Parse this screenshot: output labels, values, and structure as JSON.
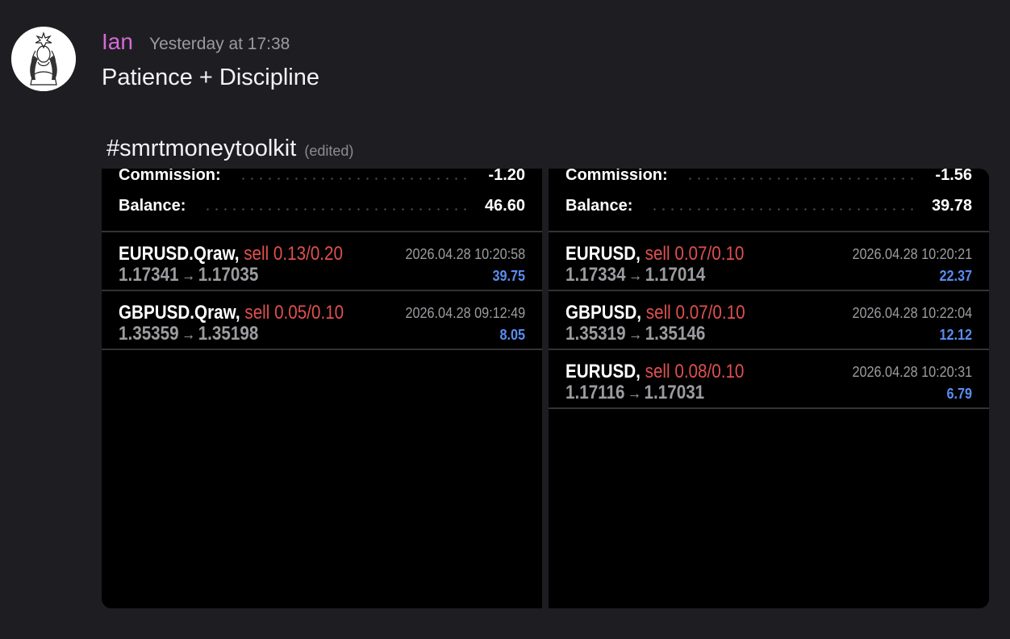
{
  "message": {
    "author": "Ian",
    "time": "Yesterday at 17:38",
    "text": "Patience + Discipline",
    "hashtag": "#smrtmoneytoolkit",
    "edited": "(edited)"
  },
  "screenshots": [
    {
      "summary": {
        "commission_label": "Commission:",
        "commission_value": "-1.20",
        "balance_label": "Balance:",
        "balance_value": "46.60"
      },
      "trades": [
        {
          "symbol": "EURUSD.Qraw,",
          "side": "sell 0.13/0.20",
          "datetime": "2026.04.28 10:20:58",
          "open": "1.17341",
          "arrow": "→",
          "close": "1.17035",
          "profit": "39.75"
        },
        {
          "symbol": "GBPUSD.Qraw,",
          "side": "sell 0.05/0.10",
          "datetime": "2026.04.28 09:12:49",
          "open": "1.35359",
          "arrow": "→",
          "close": "1.35198",
          "profit": "8.05"
        }
      ]
    },
    {
      "summary": {
        "commission_label": "Commission:",
        "commission_value": "-1.56",
        "balance_label": "Balance:",
        "balance_value": "39.78"
      },
      "trades": [
        {
          "symbol": "EURUSD,",
          "side": "sell 0.07/0.10",
          "datetime": "2026.04.28 10:20:21",
          "open": "1.17334",
          "arrow": "→",
          "close": "1.17014",
          "profit": "22.37"
        },
        {
          "symbol": "GBPUSD,",
          "side": "sell 0.07/0.10",
          "datetime": "2026.04.28 10:22:04",
          "open": "1.35319",
          "arrow": "→",
          "close": "1.35146",
          "profit": "12.12"
        },
        {
          "symbol": "EURUSD,",
          "side": "sell 0.08/0.10",
          "datetime": "2026.04.28 10:20:31",
          "open": "1.17116",
          "arrow": "→",
          "close": "1.17031",
          "profit": "6.79"
        }
      ]
    }
  ],
  "colors": {
    "background": "#1e1e22",
    "author": "#d46ad8",
    "sell": "#e0504f",
    "profit": "#5b8cf0"
  },
  "icons": {
    "avatar": "woman-portrait-avatar"
  }
}
